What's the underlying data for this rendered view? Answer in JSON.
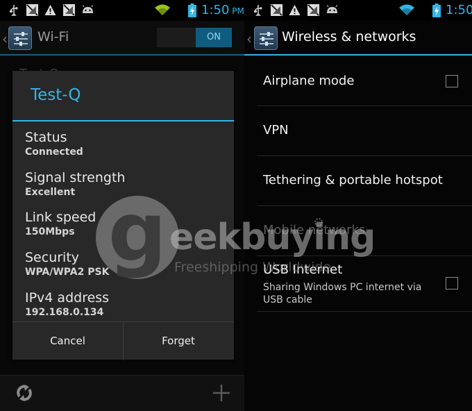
{
  "colors": {
    "accent": "#33b5e5",
    "dialog_bg": "#282828",
    "toggle_on": "#0e5d80"
  },
  "left": {
    "statusbar": {
      "icons": [
        "usb-icon",
        "no-signal-icon",
        "warning-icon",
        "no-signal-icon",
        "android-icon",
        "wifi-icon",
        "battery-charging-icon"
      ],
      "time": "1:50",
      "ampm": "PM"
    },
    "actionbar": {
      "title": "Wi-Fi",
      "toggle_label": "ON"
    },
    "behind_item": "Test-Q",
    "dialog": {
      "title": "Test-Q",
      "rows": [
        {
          "label": "Status",
          "value": "Connected"
        },
        {
          "label": "Signal strength",
          "value": "Excellent"
        },
        {
          "label": "Link speed",
          "value": "150Mbps"
        },
        {
          "label": "Security",
          "value": "WPA/WPA2 PSK"
        },
        {
          "label": "IPv4 address",
          "value": "192.168.0.134"
        }
      ],
      "cancel_label": "Cancel",
      "forget_label": "Forget"
    },
    "bottom_bar": {
      "icons": [
        "refresh-icon",
        "add-icon"
      ]
    }
  },
  "right": {
    "statusbar": {
      "icons": [
        "usb-icon",
        "no-signal-icon",
        "warning-icon",
        "no-signal-icon",
        "android-icon",
        "wifi-icon",
        "battery-charging-icon"
      ],
      "time": "1:50"
    },
    "actionbar": {
      "title": "Wireless & networks"
    },
    "items": [
      {
        "title": "Airplane mode",
        "checkbox": true,
        "checked": false
      },
      {
        "title": "VPN"
      },
      {
        "title": "Tethering & portable hotspot"
      },
      {
        "title": "Mobile networks",
        "disabled": true,
        "loading": true
      },
      {
        "title": "USB Internet",
        "subtitle": "Sharing Windows PC internet via USB cable",
        "checkbox": true,
        "checked": false
      }
    ]
  },
  "watermark": {
    "logo_letter": "g",
    "brand": "eekbuying",
    "tagline": "Freeshipping Worldwide"
  }
}
